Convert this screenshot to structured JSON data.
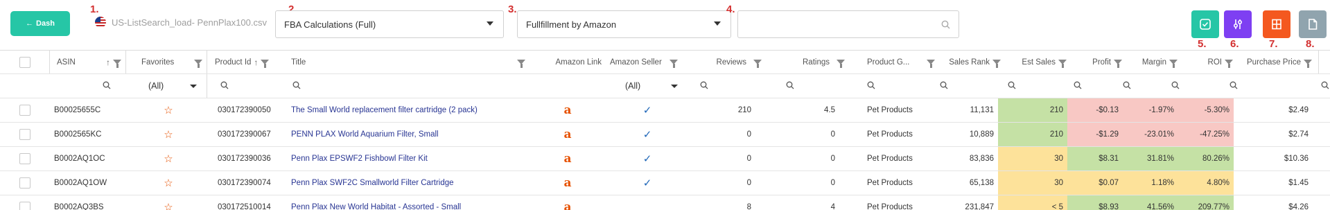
{
  "toolbar": {
    "dash_label": "Dash",
    "back_arrow": "←",
    "step1": "1.",
    "step2": "2.",
    "step3": "3.",
    "step4": "4.",
    "step5": "5.",
    "step6": "6.",
    "step7": "7.",
    "step8": "8.",
    "file_name": "US-ListSearch_load- PennPlax100.csv",
    "calc_select": "FBA Calculations (Full)",
    "fulfillment_select": "Fullfillment by Amazon",
    "search_value": "",
    "btn_colors": {
      "approve": "#26c6a6",
      "settings": "#7e3ff2",
      "columns": "#f4581f",
      "export": "#90a4ae"
    }
  },
  "grid": {
    "headers": {
      "asin": "ASIN",
      "favorites": "Favorites",
      "product_id": "Product Id",
      "title": "Title",
      "amazon_link": "Amazon Link",
      "amazon_seller": "Amazon Seller",
      "reviews": "Reviews",
      "ratings": "Ratings",
      "product_group": "Product G...",
      "sales_rank": "Sales Rank",
      "est_sales": "Est Sales",
      "profit": "Profit",
      "margin": "Margin",
      "roi": "ROI",
      "purchase_price": "Purchase Price"
    },
    "filters": {
      "favorites": "(All)",
      "amazon_seller": "(All)"
    },
    "rows": [
      {
        "asin": "B00025655C",
        "product_id": "030172390050",
        "title": "The Small World replacement filter cartridge (2 pack)",
        "seller": true,
        "reviews": "210",
        "ratings": "4.5",
        "group": "Pet Products",
        "rank": "11,131",
        "est_sales": "210",
        "profit": "-$0.13",
        "margin": "-1.97%",
        "roi": "-5.30%",
        "price": "$2.49"
      },
      {
        "asin": "B0002565KC",
        "product_id": "030172390067",
        "title": "PENN PLAX World Aquarium Filter, Small",
        "seller": true,
        "reviews": "0",
        "ratings": "0",
        "group": "Pet Products",
        "rank": "10,889",
        "est_sales": "210",
        "profit": "-$1.29",
        "margin": "-23.01%",
        "roi": "-47.25%",
        "price": "$2.74"
      },
      {
        "asin": "B0002AQ1OC",
        "product_id": "030172390036",
        "title": "Penn Plax EPSWF2 Fishbowl Filter Kit",
        "seller": true,
        "reviews": "0",
        "ratings": "0",
        "group": "Pet Products",
        "rank": "83,836",
        "est_sales": "30",
        "profit": "$8.31",
        "margin": "31.81%",
        "roi": "80.26%",
        "price": "$10.36"
      },
      {
        "asin": "B0002AQ1OW",
        "product_id": "030172390074",
        "title": "Penn Plax SWF2C Smallworld Filter Cartridge",
        "seller": true,
        "reviews": "0",
        "ratings": "0",
        "group": "Pet Products",
        "rank": "65,138",
        "est_sales": "30",
        "profit": "$0.07",
        "margin": "1.18%",
        "roi": "4.80%",
        "price": "$1.45"
      },
      {
        "asin": "B0002AQ3BS",
        "product_id": "030172510014",
        "title": "Penn Plax New World Habitat - Assorted - Small",
        "seller": false,
        "reviews": "8",
        "ratings": "4",
        "group": "Pet Products",
        "rank": "231,847",
        "est_sales": "< 5",
        "profit": "$8.93",
        "margin": "41.56%",
        "roi": "209.77%",
        "price": "$4.26"
      }
    ],
    "row_colors": [
      {
        "est": "bg-green",
        "profit": "bg-red",
        "margin": "bg-red",
        "roi": "bg-red"
      },
      {
        "est": "bg-green",
        "profit": "bg-red",
        "margin": "bg-red",
        "roi": "bg-red"
      },
      {
        "est": "bg-yellow",
        "profit": "bg-green",
        "margin": "bg-green",
        "roi": "bg-green"
      },
      {
        "est": "bg-yellow",
        "profit": "bg-yellow",
        "margin": "bg-yellow",
        "roi": "bg-yellow"
      },
      {
        "est": "bg-yellow",
        "profit": "bg-green",
        "margin": "bg-green",
        "roi": "bg-green"
      }
    ]
  }
}
